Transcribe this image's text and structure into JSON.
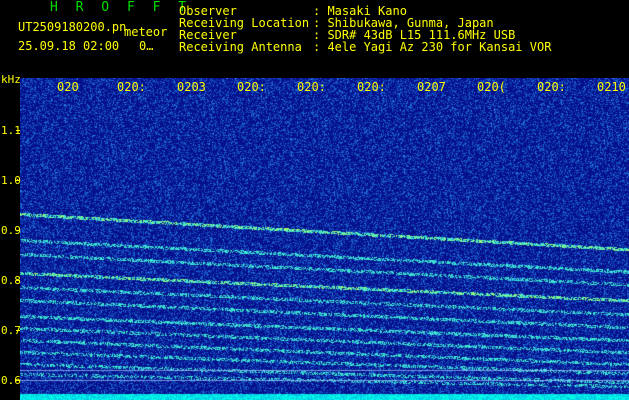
{
  "app": {
    "title": "H R O F F T",
    "file_name": "UT2509180200.pn",
    "tag": "meteor",
    "timestamp": "25.09.18 02:00",
    "counter": "0…"
  },
  "info": {
    "rows": [
      {
        "label": "Observer",
        "value": ": Masaki Kano"
      },
      {
        "label": "Receiving Location",
        "value": ": Shibukawa, Gunma, Japan"
      },
      {
        "label": "Receiver",
        "value": ": SDR# 43dB L15 111.6MHz USB"
      },
      {
        "label": "Receiving Antenna",
        "value": ": 4ele Yagi Az 230 for Kansai VOR"
      }
    ]
  },
  "axes": {
    "y_unit": "kHz",
    "y_ticks": [
      "1.1",
      "1.0",
      "0.9",
      "0.8",
      "0.7",
      "0.6"
    ],
    "x_ticks": [
      "020",
      "020:",
      "0203",
      "020:",
      "020:",
      "020:",
      "0207",
      "020(",
      "020:",
      "0210"
    ]
  },
  "colors": {
    "background": "#06118c",
    "header_text": "#ffff00",
    "title_text": "#00e000",
    "signal": "#7fffd4"
  }
}
